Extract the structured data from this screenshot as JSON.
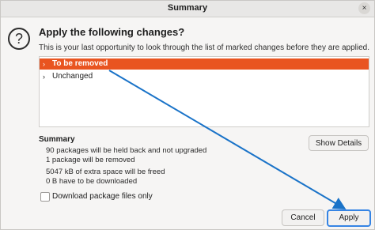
{
  "window": {
    "title": "Summary",
    "close_glyph": "×"
  },
  "dialog": {
    "icon": "question-icon",
    "icon_glyph": "?",
    "heading": "Apply the following changes?",
    "description": "This is your last opportunity to look through the list of marked changes before they are applied."
  },
  "changes": {
    "rows": [
      {
        "chevron": "›",
        "label": "To be removed",
        "selected": true
      },
      {
        "chevron": "›",
        "label": "Unchanged",
        "selected": false
      }
    ],
    "selected_color": "#e95420"
  },
  "summary": {
    "heading": "Summary",
    "lines": [
      "90 packages will be held back and not upgraded",
      "1 package will be removed",
      "5047 kB of extra space will be freed",
      "0  B have to be downloaded"
    ],
    "show_details_label": "Show Details"
  },
  "options": {
    "download_only_label": "Download package files only",
    "download_only_checked": false
  },
  "buttons": {
    "cancel_label": "Cancel",
    "apply_label": "Apply",
    "focus_color": "#3584e4"
  },
  "annotation": {
    "arrow_color": "#1a73c8"
  }
}
